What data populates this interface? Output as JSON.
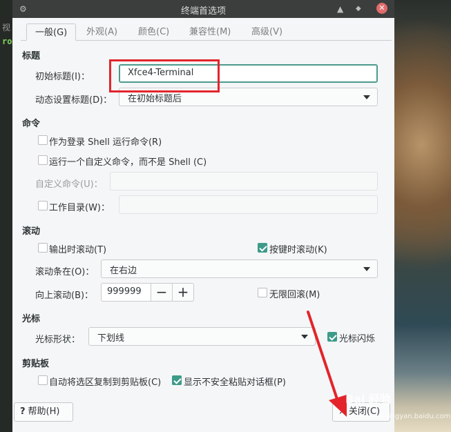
{
  "window": {
    "title": "终端首选项"
  },
  "background": {
    "terminal_label": "视",
    "terminal_prompt": "ro"
  },
  "tabs": [
    {
      "label": "一般(G)",
      "active": true
    },
    {
      "label": "外观(A)"
    },
    {
      "label": "颜色(C)"
    },
    {
      "label": "兼容性(M)"
    },
    {
      "label": "高级(V)"
    }
  ],
  "title_section": {
    "heading": "标题",
    "initial_title_label": "初始标题(I)：",
    "initial_title_value": "Xfce4-Terminal",
    "dynamic_title_label": "动态设置标题(D)：",
    "dynamic_title_value": "在初始标题后"
  },
  "command_section": {
    "heading": "命令",
    "login_shell_label": "作为登录 Shell 运行命令(R)",
    "login_shell_checked": false,
    "custom_command_label": "运行一个自定义命令，而不是 Shell (C)",
    "custom_command_checked": false,
    "custom_command_field_label": "自定义命令(U)：",
    "custom_command_value": "",
    "working_dir_label": "工作目录(W)：",
    "working_dir_checked": false,
    "working_dir_value": ""
  },
  "scroll_section": {
    "heading": "滚动",
    "scroll_on_output_label": "输出时滚动(T)",
    "scroll_on_output_checked": false,
    "scroll_on_key_label": "按键时滚动(K)",
    "scroll_on_key_checked": true,
    "scrollbar_label": "滚动条在(O)：",
    "scrollbar_value": "在右边",
    "scrollback_label": "向上滚动(B)：",
    "scrollback_value": "999999",
    "spin_minus": "−",
    "spin_plus": "+",
    "unlimited_label": "无限回滚(M)",
    "unlimited_checked": false
  },
  "cursor_section": {
    "heading": "光标",
    "shape_label": "光标形状：",
    "shape_value": "下划线",
    "blink_label": "光标闪烁",
    "blink_checked": true
  },
  "clipboard_section": {
    "heading": "剪贴板",
    "auto_copy_label": "自动将选区复制到剪贴板(C)",
    "auto_copy_checked": false,
    "unsafe_paste_label": "显示不安全粘贴对话框(P)",
    "unsafe_paste_checked": true
  },
  "footer": {
    "help_label": "帮助(H)",
    "help_icon": "?",
    "close_label": "关闭(C)",
    "close_icon": "×"
  },
  "watermark": {
    "text": "Bai 经验",
    "sub": "jingyan.baidu.com"
  },
  "colors": {
    "accent": "#3d9b89",
    "annotation": "#e3242b"
  }
}
